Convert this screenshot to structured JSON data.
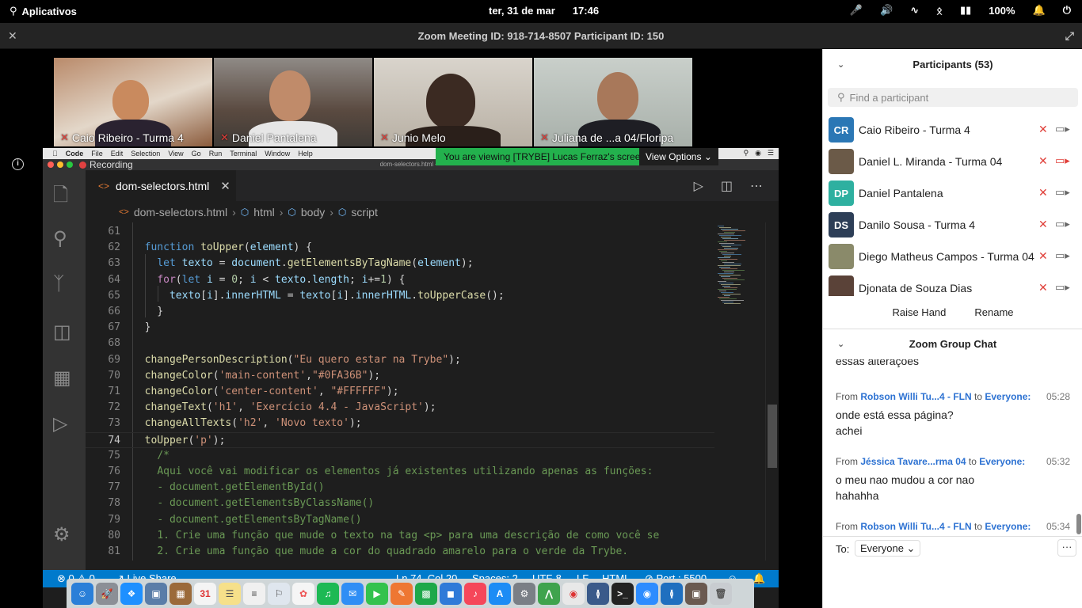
{
  "system_bar": {
    "apps_label": "Aplicativos",
    "date": "ter, 31 de mar",
    "time": "17:46",
    "battery": "100%"
  },
  "zoom": {
    "title": "Zoom Meeting ID: 918-714-8507 Participant ID: 150",
    "close_glyph": "✕",
    "expand_glyph": "⤢"
  },
  "thumbnails": [
    {
      "name": "Caio Ribeiro - Turma 4"
    },
    {
      "name": "Daniel Pantalena"
    },
    {
      "name": "Junio Melo"
    },
    {
      "name": "Juliana de ...a 04/Floripa"
    }
  ],
  "share": {
    "banner": "You are viewing [TRYBE] Lucas Ferraz's screen",
    "view_options": "View Options",
    "recording": "Recording",
    "window_title": "dom-selectors.html — ",
    "mac_menu": [
      "Code",
      "File",
      "Edit",
      "Selection",
      "View",
      "Go",
      "Run",
      "Terminal",
      "Window",
      "Help"
    ]
  },
  "editor": {
    "tab_name": "dom-selectors.html",
    "breadcrumbs": [
      "dom-selectors.html",
      "html",
      "body",
      "script"
    ],
    "lines": [
      {
        "n": "61",
        "html": ""
      },
      {
        "n": "62",
        "html": "  <span class='kw'>function</span> <span class='fn'>toUpper</span>(<span class='vr'>element</span>) {"
      },
      {
        "n": "63",
        "html": "    <span class='kw'>let</span> <span class='vr'>texto</span> = <span class='vr'>document</span>.<span class='fn'>getElementsByTagName</span>(<span class='vr'>element</span>);"
      },
      {
        "n": "64",
        "html": "    <span class='ctl'>for</span>(<span class='kw'>let</span> <span class='vr'>i</span> = <span class='nm'>0</span>; <span class='vr'>i</span> &lt; <span class='vr'>texto</span>.<span class='vr'>length</span>; <span class='vr'>i</span>+=<span class='nm'>1</span>) {"
      },
      {
        "n": "65",
        "html": "      <span class='vr'>texto</span>[<span class='vr'>i</span>].<span class='vr'>innerHTML</span> = <span class='vr'>texto</span>[<span class='vr'>i</span>].<span class='vr'>innerHTML</span>.<span class='fn'>toUpperCase</span>();"
      },
      {
        "n": "66",
        "html": "    }"
      },
      {
        "n": "67",
        "html": "  }"
      },
      {
        "n": "68",
        "html": ""
      },
      {
        "n": "69",
        "html": "  <span class='fn'>changePersonDescription</span>(<span class='str'>\"Eu quero estar na Trybe\"</span>);"
      },
      {
        "n": "70",
        "html": "  <span class='fn'>changeColor</span>(<span class='str'>'main-content'</span>,<span class='str'>\"#0FA36B\"</span>);"
      },
      {
        "n": "71",
        "html": "  <span class='fn'>changeColor</span>(<span class='str'>'center-content'</span>, <span class='str'>\"#FFFFFF\"</span>);"
      },
      {
        "n": "72",
        "html": "  <span class='fn'>changeText</span>(<span class='str'>'h1'</span>, <span class='str'>'Exercício 4.4 - JavaScript'</span>);"
      },
      {
        "n": "73",
        "html": "  <span class='fn'>changeAllTexts</span>(<span class='str'>'h2'</span>, <span class='str'>'Novo texto'</span>);"
      },
      {
        "n": "74",
        "html": "  <span class='fn'>toUpper</span>(<span class='str'>'p'</span>);"
      },
      {
        "n": "75",
        "html": "    <span class='cm'>/*</span>"
      },
      {
        "n": "76",
        "html": "    <span class='cm'>Aqui você vai modificar os elementos já existentes utilizando apenas as funções:</span>"
      },
      {
        "n": "77",
        "html": "    <span class='cm'>- document.getElementById()</span>"
      },
      {
        "n": "78",
        "html": "    <span class='cm'>- document.getElementsByClassName()</span>"
      },
      {
        "n": "79",
        "html": "    <span class='cm'>- document.getElementsByTagName()</span>"
      },
      {
        "n": "80",
        "html": "    <span class='cm'>1. Crie uma função que mude o texto na tag &lt;p&gt; para uma descrição de como você se</span>"
      },
      {
        "n": "81",
        "html": "    <span class='cm'>2. Crie uma função que mude a cor do quadrado amarelo para o verde da Trybe.</span>"
      }
    ],
    "status": {
      "errors": "0",
      "warnings": "0",
      "live_share": "Live Share",
      "position": "Ln 74, Col 20",
      "spaces": "Spaces: 2",
      "encoding": "UTF-8",
      "eol": "LF",
      "language": "HTML",
      "port": "Port : 5500"
    }
  },
  "participants": {
    "header": "Participants (53)",
    "search_placeholder": "Find a participant",
    "items": [
      {
        "initials": "CR",
        "name": "Caio Ribeiro - Turma 4",
        "avatar_color": "#2b77b5",
        "cam_off": false
      },
      {
        "initials": "",
        "name": "Daniel L. Miranda - Turma 04",
        "avatar_color": "#6b5a48",
        "cam_off": true
      },
      {
        "initials": "DP",
        "name": "Daniel Pantalena",
        "avatar_color": "#2eb0a0",
        "cam_off": false
      },
      {
        "initials": "DS",
        "name": "Danilo Sousa - Turma 4",
        "avatar_color": "#2d3e57",
        "cam_off": false
      },
      {
        "initials": "",
        "name": "Diego Matheus Campos - Turma 04",
        "avatar_color": "#8a8a6a",
        "cam_off": false
      },
      {
        "initials": "",
        "name": "Djonata de Souza Dias",
        "avatar_color": "#5a4238",
        "cam_off": false
      }
    ],
    "raise_hand": "Raise Hand",
    "rename": "Rename"
  },
  "chat": {
    "header": "Zoom Group Chat",
    "partial_text": "essas alterações",
    "from_label": "From",
    "to_label": "to",
    "messages": [
      {
        "from": "Robson Willi Tu...4 - FLN",
        "to": "Everyone:",
        "time": "05:28",
        "lines": [
          "onde está essa página?",
          "achei"
        ]
      },
      {
        "from": "Jéssica Tavare...rma 04",
        "to": "Everyone:",
        "time": "05:32",
        "lines": [
          "o meu nao mudou a cor nao",
          "hahahha"
        ]
      },
      {
        "from": "Robson Willi Tu...4 - FLN",
        "to": "Everyone:",
        "time": "05:34",
        "lines": []
      }
    ],
    "to_prefix": "To:",
    "recipient": "Everyone",
    "more_glyph": "···"
  },
  "colors": {
    "vscode_blue": "#007acc",
    "zoom_green": "#23b14d",
    "zoom_link": "#2d72d2",
    "mute_red": "#e0403a"
  }
}
